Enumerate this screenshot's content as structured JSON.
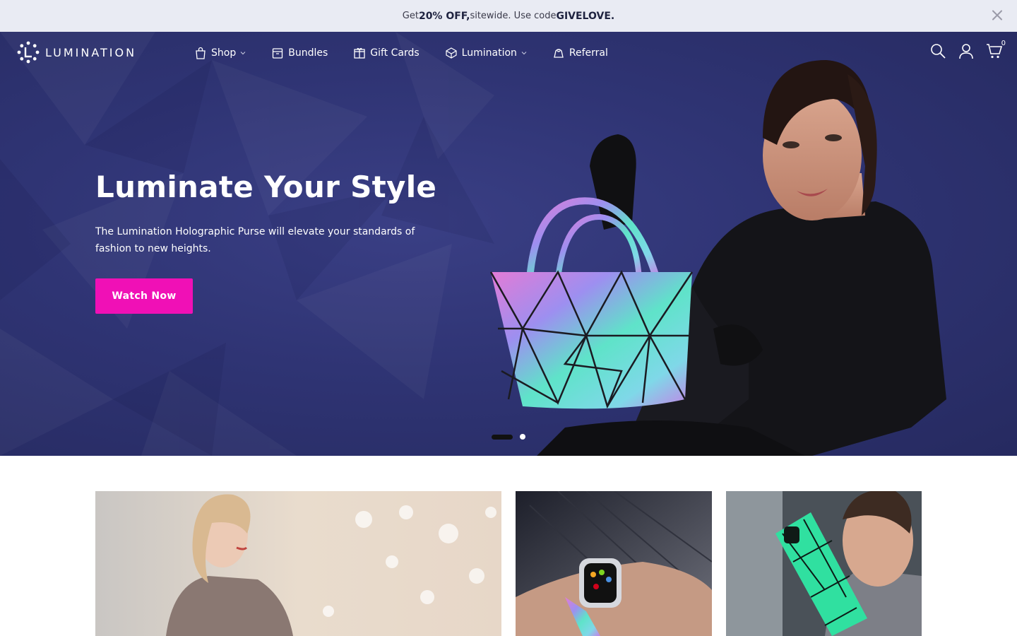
{
  "announcement": {
    "prefix": "Get ",
    "discount": "20% OFF,",
    "middle": " sitewide. Use code ",
    "code": "GIVELOVE."
  },
  "brand": {
    "name": "LUMINATION"
  },
  "nav": {
    "items": [
      {
        "label": "Shop",
        "icon": "shopping-bag-icon",
        "dropdown": true
      },
      {
        "label": "Bundles",
        "icon": "box-icon",
        "dropdown": false
      },
      {
        "label": "Gift Cards",
        "icon": "gift-icon",
        "dropdown": false
      },
      {
        "label": "Lumination",
        "icon": "prism-icon",
        "dropdown": true
      },
      {
        "label": "Referral",
        "icon": "referral-icon",
        "dropdown": false
      }
    ]
  },
  "header_icons": {
    "search": "search-icon",
    "account": "user-icon",
    "cart": "cart-icon",
    "cart_count": "0"
  },
  "hero": {
    "title": "Luminate Your Style",
    "description": "The Lumination Holographic Purse will elevate your standards of fashion to new heights.",
    "button_label": "Watch Now",
    "slides": 2,
    "active_slide": 1
  },
  "colors": {
    "announcement_bg": "#e9ebf3",
    "hero_bg": "#2f3474",
    "accent": "#f010b6",
    "text_light": "#ffffff"
  },
  "banners": [
    {
      "subject": "woman-in-mall"
    },
    {
      "subject": "holographic-watch-band"
    },
    {
      "subject": "holographic-phone-case"
    }
  ]
}
